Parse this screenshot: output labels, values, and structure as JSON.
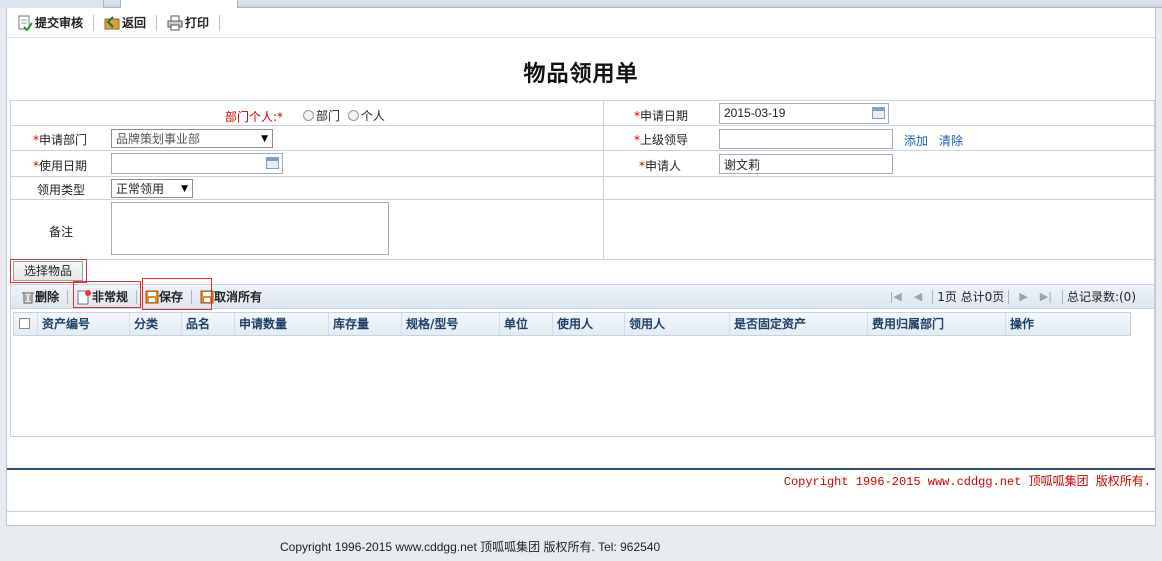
{
  "toolbar": {
    "submit": "提交审核",
    "back": "返回",
    "print": "打印"
  },
  "page_title": "物品领用单",
  "form": {
    "dept_person_label": "部门个人:",
    "dept_person_star": "*",
    "radio_dept": "部门",
    "radio_person": "个人",
    "apply_date_label": "申请日期",
    "apply_date_value": "2015-03-19",
    "apply_dept_label": "申请部门",
    "apply_dept_value": "品牌策划事业部",
    "superior_label": "上级领导",
    "superior_value": "",
    "add_link": "添加",
    "clear_link": "清除",
    "use_date_label": "使用日期",
    "use_date_value": "",
    "applicant_label": "申请人",
    "applicant_value": "谢文莉",
    "type_label": "领用类型",
    "type_value": "正常领用",
    "remark_label": "备注",
    "remark_value": ""
  },
  "select_goods": "选择物品",
  "grid": {
    "delete": "删除",
    "irregular": "非常规",
    "save": "保存",
    "cancel_all": "取消所有",
    "pager_text": "1页 总计0页",
    "total_records": "总记录数:(0)",
    "columns": [
      "资产编号",
      "分类",
      "品名",
      "申请数量",
      "库存量",
      "规格/型号",
      "单位",
      "使用人",
      "领用人",
      "是否固定资产",
      "费用归属部门",
      "操作"
    ]
  },
  "copyright_red": "Copyright 1996-2015 www.cddgg.net 顶呱呱集团 版权所有.",
  "footer": "Copyright 1996-2015 www.cddgg.net 顶呱呱集团 版权所有. Tel: 962540",
  "colors": {
    "required": "#dd0000",
    "link": "#1a5fb4",
    "header_text": "#1f3f66",
    "divider": "#2b4f6e"
  }
}
